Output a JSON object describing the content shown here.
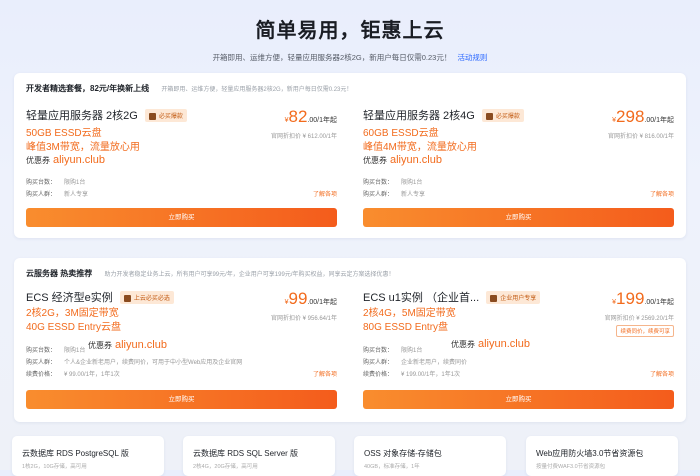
{
  "hero": {
    "title": "简单易用，钜惠上云",
    "subtitle": "开箱即用、运维方便，轻量应用服务器2核2G，新用户每日仅需0.23元！",
    "link": "活动规则"
  },
  "section1": {
    "heading": "开发者精选套餐，82元/年换新上线",
    "note": "开箱即用、运维方便，轻量应用服务器2核2G，新用户每日仅需0.23元！",
    "cards": [
      {
        "title": "轻量应用服务器 2核2G",
        "badge": "必买爆款",
        "spec1": "50GB ESSD云盘",
        "spec2": "峰值3M带宽，流量放心用",
        "coupon_label": "优惠券",
        "coupon_code": "aliyun.club",
        "meta1_label": "购买台数：",
        "meta1_value": "限购1台",
        "meta2_label": "购买人群：",
        "meta2_value": "新人专享",
        "price_cur": "¥",
        "price_num": "82",
        "price_unit": ".00/1年起",
        "orig": "官网折扣价 ¥ 612.00/1年",
        "detail": "了解各项",
        "buy": "立即购买"
      },
      {
        "title": "轻量应用服务器 2核4G",
        "badge": "必买爆款",
        "spec1": "60GB ESSD云盘",
        "spec2": "峰值4M带宽，流量放心用",
        "coupon_label": "优惠券",
        "coupon_code": "aliyun.club",
        "meta1_label": "购买台数：",
        "meta1_value": "限购1台",
        "meta2_label": "购买人群：",
        "meta2_value": "新人专享",
        "price_cur": "¥",
        "price_num": "298",
        "price_unit": ".00/1年起",
        "orig": "官网折扣价 ¥ 816.00/1年",
        "detail": "了解各项",
        "buy": "立即购买"
      }
    ]
  },
  "section2": {
    "heading": "云服务器 热卖推荐",
    "note": "助力开发者稳定业务上云，所有用户可享99元/年，企业用户可享199元/年购买权益，同享云定方案选择优惠！",
    "cards": [
      {
        "title": "ECS 经济型e实例",
        "badge": "上云必买必选",
        "spec1": "2核2G，3M固定带宽",
        "spec2": "40G ESSD Entry云盘",
        "coupon_label": "优惠券",
        "coupon_code": "aliyun.club",
        "meta1_label": "购买台数：",
        "meta1_value": "限购1台",
        "meta2_label": "购买人群：",
        "meta2_value": "个人&企业新老用户，续费同价，可用于中小型Web应用及企业官网",
        "meta3_label": "续费价格：",
        "meta3_value": "¥ 99.00/1年，1年1次",
        "price_cur": "¥",
        "price_num": "99",
        "price_unit": ".00/1年起",
        "orig": "官网折扣价 ¥ 956.64/1年",
        "detail": "了解各项",
        "buy": "立即购买"
      },
      {
        "title": "ECS u1实例 （企业首...",
        "badge": "企业用户专享",
        "spec1": "2核4G，5M固定带宽",
        "spec2": "80G ESSD Entry盘",
        "coupon_label": "优惠券",
        "coupon_code": "aliyun.club",
        "meta1_label": "购买台数：",
        "meta1_value": "限购1台",
        "meta2_label": "购买人群：",
        "meta2_value": "企业新老用户，续费同价",
        "meta3_label": "续费价格：",
        "meta3_value": "¥ 199.00/1年，1年1次",
        "price_cur": "¥",
        "price_num": "199",
        "price_unit": ".00/1年起",
        "orig": "官网折扣价 ¥ 2569.20/1年",
        "orig_tag": "续费同价，续费可享",
        "detail": "了解各项",
        "buy": "立即购买"
      }
    ]
  },
  "bottom_cards": [
    {
      "title": "云数据库 RDS PostgreSQL 版",
      "sub": "1核2G，10G存储，高可用"
    },
    {
      "title": "云数据库 RDS SQL Server 版",
      "sub": "2核4G，20G存储，高可用"
    },
    {
      "title": "OSS 对象存储-存储包",
      "sub": "40GB，标准存储，1年"
    },
    {
      "title": "Web应用防火墙3.0节省资源包",
      "sub": "按量付费WAF3.0节省资源包"
    }
  ]
}
